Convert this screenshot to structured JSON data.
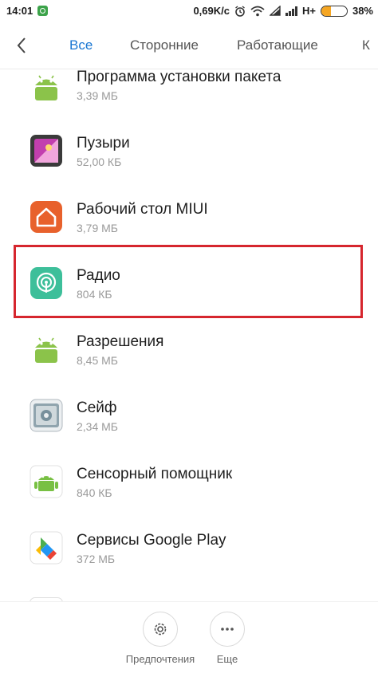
{
  "status_bar": {
    "time": "14:01",
    "network_speed": "0,69K/c",
    "network_type": "H+",
    "battery_percent": "38%",
    "battery_level": 0.38,
    "icons": [
      "message-icon",
      "alarm-icon",
      "wifi-icon",
      "cellular-signal-icon",
      "battery-icon"
    ]
  },
  "tabs": {
    "all": "Все",
    "third_party": "Сторонние",
    "running": "Работающие",
    "cut_off": "К"
  },
  "apps": [
    {
      "name": "Программа установки пакета",
      "size": "3,39 МБ",
      "icon": "android-icon"
    },
    {
      "name": "Пузыри",
      "size": "52,00 КБ",
      "icon": "bubbles-wallpaper-icon"
    },
    {
      "name": "Рабочий стол MIUI",
      "size": "3,79 МБ",
      "icon": "home-icon"
    },
    {
      "name": "Радио",
      "size": "804 КБ",
      "icon": "radio-icon"
    },
    {
      "name": "Разрешения",
      "size": "8,45 МБ",
      "icon": "android-icon"
    },
    {
      "name": "Сейф",
      "size": "2,34 МБ",
      "icon": "safe-icon"
    },
    {
      "name": "Сенсорный помощник",
      "size": "840 КБ",
      "icon": "android-icon"
    },
    {
      "name": "Сервисы Google Play",
      "size": "372 МБ",
      "icon": "google-play-services-icon"
    }
  ],
  "bottom_bar": {
    "preferences": "Предпочтения",
    "more": "Еще"
  },
  "colors": {
    "active_tab": "#1976d2",
    "highlight_border": "#d6262e",
    "android_green": "#8bc34a",
    "radio_teal": "#3dbf9a",
    "home_orange": "#e8612c"
  }
}
